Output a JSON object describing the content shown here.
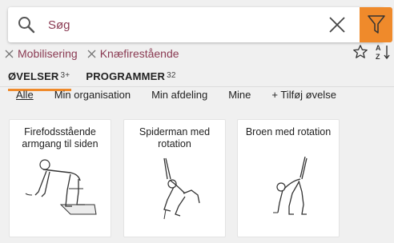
{
  "search": {
    "value": "",
    "placeholder": "Søg"
  },
  "filters": [
    {
      "label": "Mobilisering"
    },
    {
      "label": "Knæfirestående"
    }
  ],
  "tabs": [
    {
      "label": "ØVELSER",
      "count": "3+",
      "active": true
    },
    {
      "label": "PROGRAMMER",
      "count": "32",
      "active": false
    }
  ],
  "scopes": [
    {
      "label": "Alle",
      "active": true
    },
    {
      "label": "Min organisation"
    },
    {
      "label": "Min afdeling"
    },
    {
      "label": "Mine"
    },
    {
      "label": "+ Tilføj øvelse"
    }
  ],
  "cards": [
    {
      "title": "Firefodsstående armgang til siden",
      "illustration": "exercise-figure-kneeling-on-mat"
    },
    {
      "title": "Spiderman med rotation",
      "illustration": "exercise-figure-lunge-rotation"
    },
    {
      "title": "Broen med rotation",
      "illustration": "exercise-figure-bridge-rotation"
    }
  ],
  "icons": [
    "search-icon",
    "clear-icon",
    "filter-icon",
    "close-icon",
    "star-icon",
    "sort-az-icon"
  ],
  "colors": {
    "accent": "#ef8a2b",
    "chip_text": "#8a3a52",
    "background": "#f0f0f0"
  }
}
